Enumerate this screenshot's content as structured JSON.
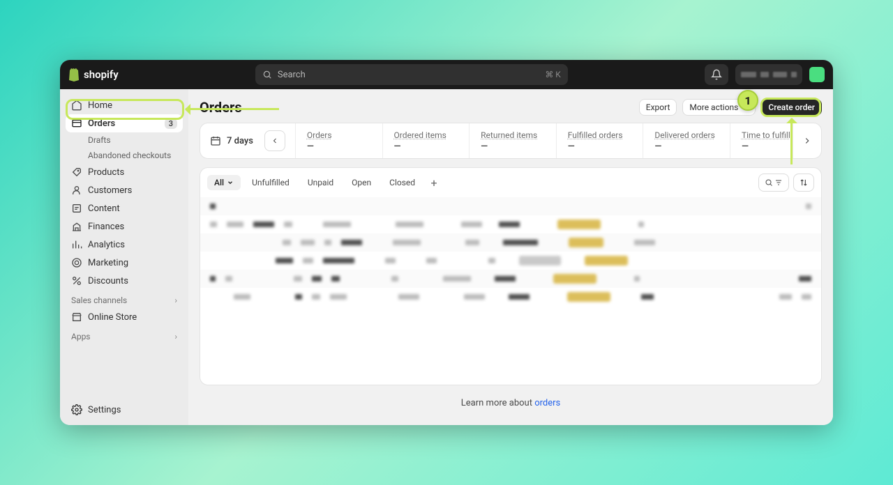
{
  "topbar": {
    "brand": "shopify",
    "search_placeholder": "Search",
    "search_shortcut": "⌘ K"
  },
  "sidebar": {
    "items": [
      {
        "label": "Home",
        "icon": "home-icon"
      },
      {
        "label": "Orders",
        "icon": "orders-icon",
        "badge": "3",
        "active": true
      },
      {
        "label": "Products",
        "icon": "products-icon"
      },
      {
        "label": "Customers",
        "icon": "customers-icon"
      },
      {
        "label": "Content",
        "icon": "content-icon"
      },
      {
        "label": "Finances",
        "icon": "finances-icon"
      },
      {
        "label": "Analytics",
        "icon": "analytics-icon"
      },
      {
        "label": "Marketing",
        "icon": "marketing-icon"
      },
      {
        "label": "Discounts",
        "icon": "discounts-icon"
      }
    ],
    "orders_sub": [
      {
        "label": "Drafts"
      },
      {
        "label": "Abandoned checkouts"
      }
    ],
    "sections": {
      "sales_channels": "Sales channels",
      "apps": "Apps"
    },
    "online_store": "Online Store",
    "settings": "Settings"
  },
  "page": {
    "title": "Orders",
    "export_label": "Export",
    "more_actions_label": "More actions",
    "create_order_label": "Create order"
  },
  "stats": {
    "range_label": "7 days",
    "columns": [
      {
        "label": "Orders",
        "value": "—"
      },
      {
        "label": "Ordered items",
        "value": "—"
      },
      {
        "label": "Returned items",
        "value": "—"
      },
      {
        "label": "Fulfilled orders",
        "value": "—"
      },
      {
        "label": "Delivered orders",
        "value": "—"
      },
      {
        "label": "Time to fulfill",
        "value": "—"
      }
    ]
  },
  "tabs": [
    {
      "label": "All",
      "active": true
    },
    {
      "label": "Unfulfilled"
    },
    {
      "label": "Unpaid"
    },
    {
      "label": "Open"
    },
    {
      "label": "Closed"
    }
  ],
  "footer": {
    "learn_prefix": "Learn more about ",
    "learn_link": "orders"
  },
  "callout": {
    "number": "1"
  }
}
